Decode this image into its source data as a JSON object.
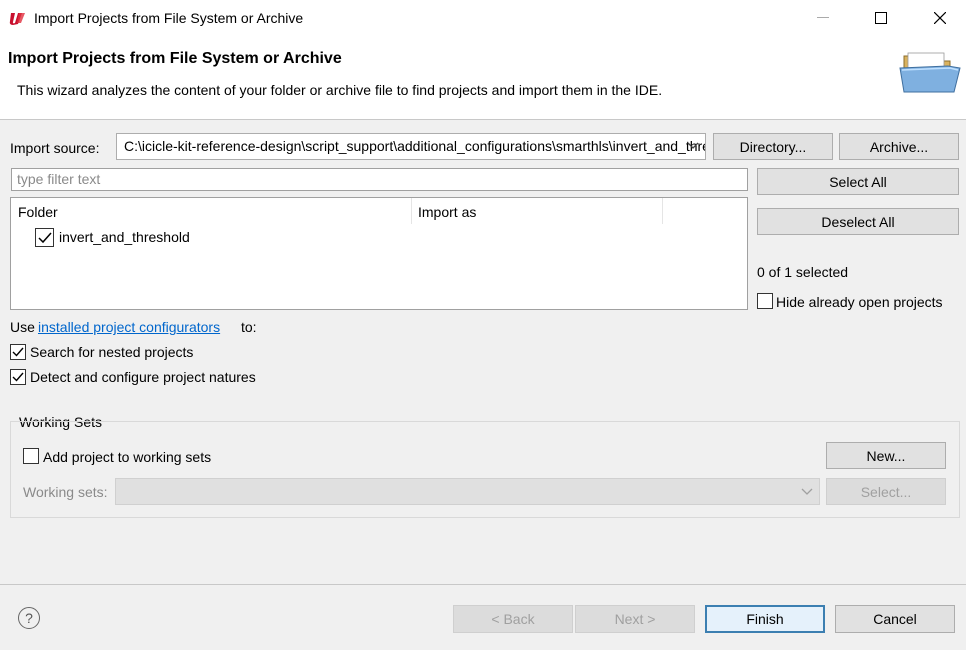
{
  "window": {
    "title": "Import Projects from File System or Archive",
    "controls": [
      "minimize-icon",
      "maximize-icon",
      "close-icon"
    ]
  },
  "banner": {
    "title": "Import Projects from File System or Archive",
    "description": "This wizard analyzes the content of your folder or archive file to find projects and import them in the IDE.",
    "icon": "folder-open-icon"
  },
  "import_source": {
    "label": "Import source:",
    "value": "C:\\icicle-kit-reference-design\\script_support\\additional_configurations\\smarthls\\invert_and_threshold",
    "directory_button": "Directory...",
    "archive_button": "Archive..."
  },
  "filter": {
    "placeholder": "type filter text"
  },
  "table": {
    "columns": [
      "Folder",
      "Import as"
    ],
    "rows": [
      {
        "folder": "invert_and_threshold",
        "import_as": "",
        "checked": true
      }
    ]
  },
  "selection": {
    "select_all": "Select All",
    "deselect_all": "Deselect All",
    "status": "0 of 1 selected",
    "hide_open_label": "Hide already open projects",
    "hide_open_checked": false
  },
  "configurators": {
    "prefix": "Use",
    "link": "installed project configurators",
    "suffix": "to:",
    "nested_label": "Search for nested projects",
    "nested_checked": true,
    "natures_label": "Detect and configure project natures",
    "natures_checked": true
  },
  "working_sets": {
    "group_title": "Working Sets",
    "add_label": "Add project to working sets",
    "add_checked": false,
    "new_button": "New...",
    "sets_label": "Working sets:",
    "select_button": "Select..."
  },
  "footer": {
    "back": "< Back",
    "next": "Next >",
    "finish": "Finish",
    "cancel": "Cancel",
    "help_icon": "help-icon"
  },
  "colors": {
    "accent": "#3c7fb1",
    "link": "#0066cc",
    "background": "#f0f0f0"
  }
}
